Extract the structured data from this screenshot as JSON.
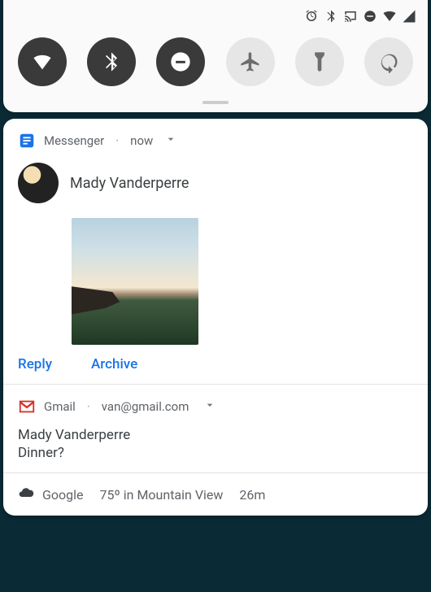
{
  "status_icons": [
    "alarm-icon",
    "bluetooth-icon",
    "cast-icon",
    "dnd-icon",
    "wifi-icon",
    "signal-icon"
  ],
  "toggles": [
    {
      "name": "wifi-toggle",
      "icon": "wifi",
      "active": true
    },
    {
      "name": "bluetooth-toggle",
      "icon": "bluetooth",
      "active": true
    },
    {
      "name": "dnd-toggle",
      "icon": "dnd",
      "active": true
    },
    {
      "name": "airplane-toggle",
      "icon": "airplane",
      "active": false
    },
    {
      "name": "flashlight-toggle",
      "icon": "flashlight",
      "active": false
    },
    {
      "name": "rotate-toggle",
      "icon": "rotate",
      "active": false
    }
  ],
  "notif_messenger": {
    "app_label": "Messenger",
    "time": "now",
    "sender": "Mady Vanderperre",
    "actions": {
      "reply": "Reply",
      "archive": "Archive"
    }
  },
  "notif_gmail": {
    "app_label": "Gmail",
    "account": "van@gmail.com",
    "sender": "Mady Vanderperre",
    "subject": "Dinner?"
  },
  "notif_weather": {
    "source": "Google",
    "summary": "75º in Mountain View",
    "age": "26m"
  }
}
